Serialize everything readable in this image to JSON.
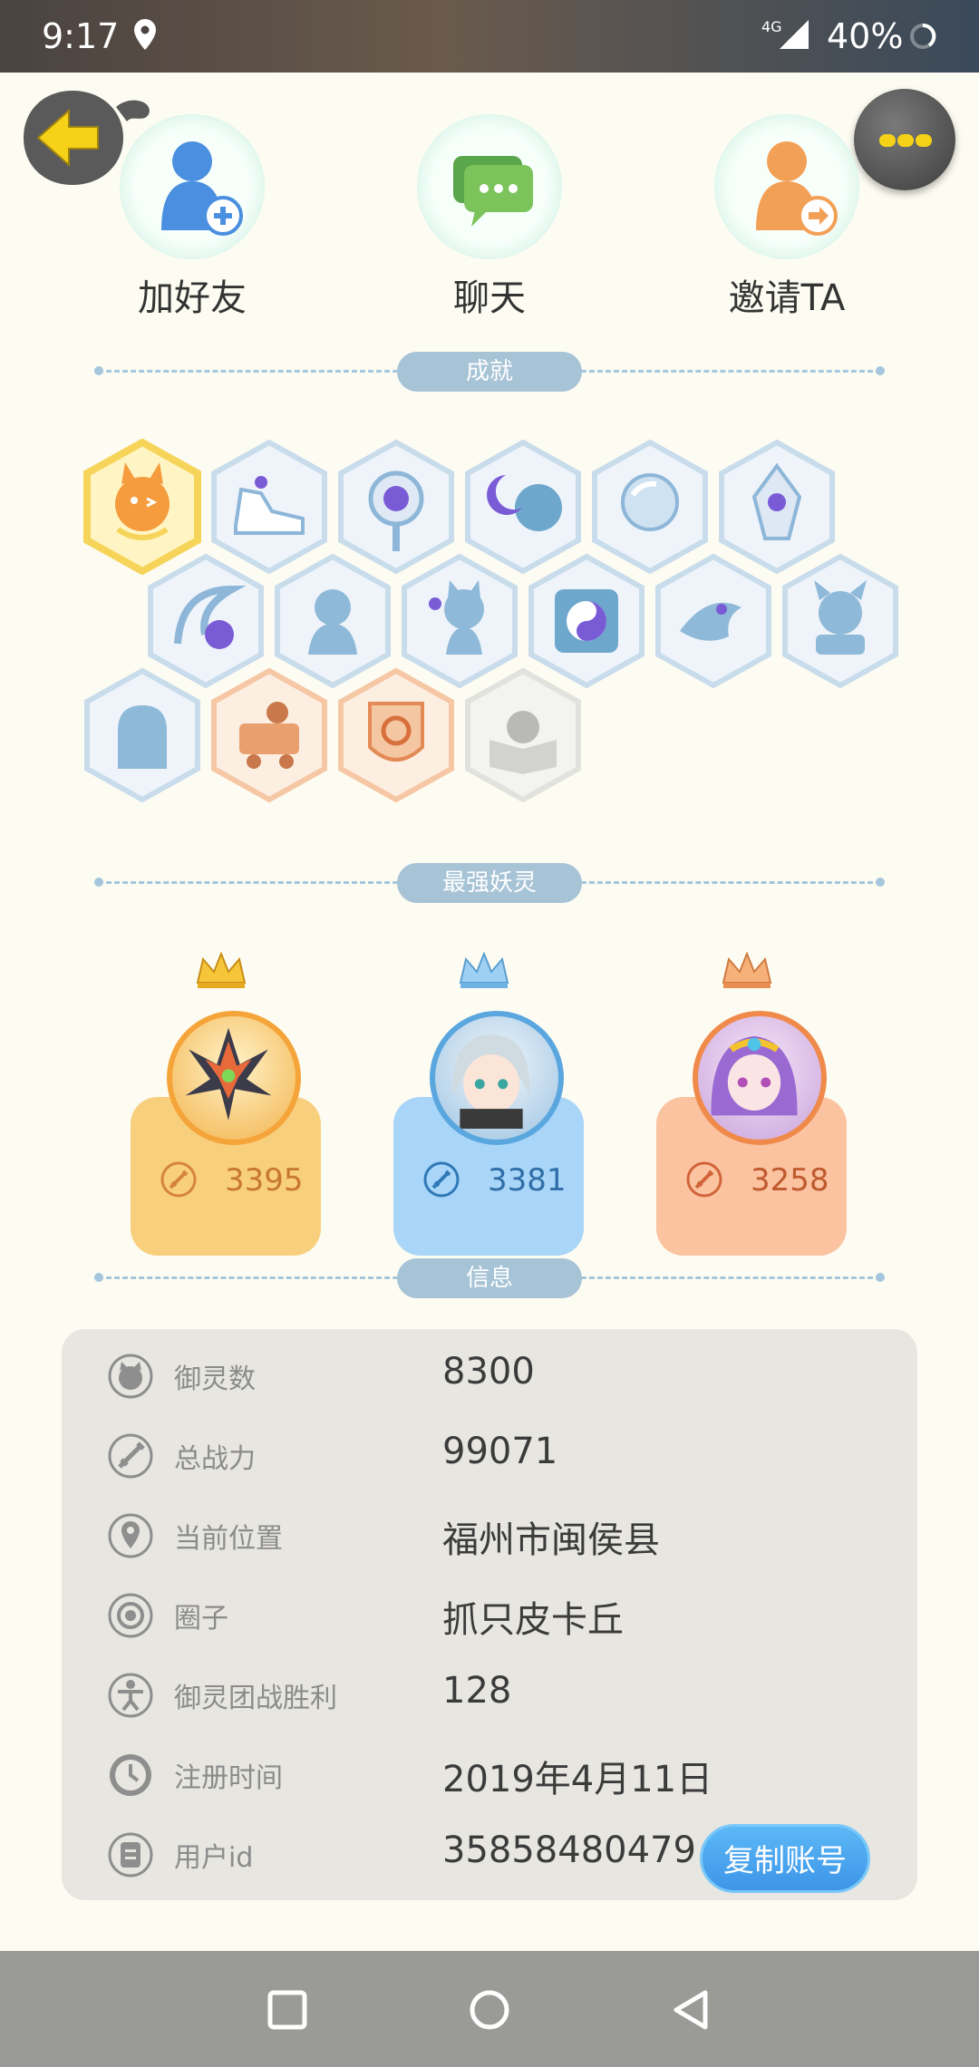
{
  "status_bar": {
    "time": "9:17",
    "network": "4G",
    "battery": "40%"
  },
  "actions": [
    {
      "label": "加好友",
      "icon": "add-friend-icon"
    },
    {
      "label": "聊天",
      "icon": "chat-icon"
    },
    {
      "label": "邀请TA",
      "icon": "invite-icon"
    }
  ],
  "sections": {
    "achievements": "成就",
    "strongest": "最强妖灵",
    "info": "信息"
  },
  "strongest_spirits": [
    {
      "value": "3395",
      "rank_color": "#f7c36a"
    },
    {
      "value": "3381",
      "rank_color": "#a8d4f6"
    },
    {
      "value": "3258",
      "rank_color": "#f9c19a"
    }
  ],
  "info": {
    "rows": [
      {
        "label": "御灵数",
        "value": "8300",
        "icon": "spirit-count-icon"
      },
      {
        "label": "总战力",
        "value": "99071",
        "icon": "sword-icon"
      },
      {
        "label": "当前位置",
        "value": "福州市闽侯县",
        "icon": "location-pin-icon"
      },
      {
        "label": "圈子",
        "value": "抓只皮卡丘",
        "icon": "circle-target-icon"
      },
      {
        "label": "御灵团战胜利",
        "value": "128",
        "icon": "team-victory-icon"
      },
      {
        "label": "注册时间",
        "value": "2019年4月11日",
        "icon": "clock-icon"
      },
      {
        "label": "用户id",
        "value": "35858480479",
        "icon": "id-card-icon"
      }
    ],
    "copy_button": "复制账号"
  },
  "colors": {
    "accent_blue": "#3d95e8",
    "section_pill": "#a7c3d6",
    "gold": "#f7c36a"
  }
}
